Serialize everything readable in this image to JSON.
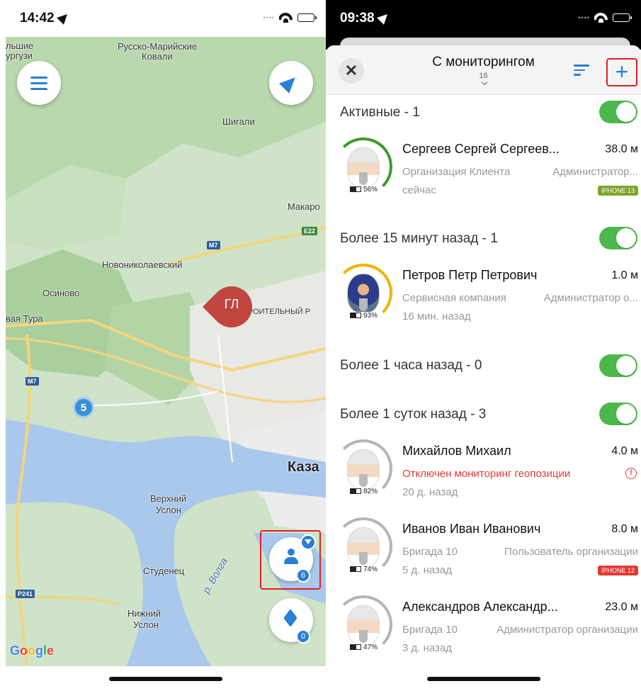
{
  "left": {
    "status": {
      "time": "14:42"
    },
    "map": {
      "labels": {
        "top_left": "льшие\nургузи",
        "russko": "Русско-Марийские",
        "kovali": "Ковали",
        "shigali": "Шигали",
        "makaro": "Макаро",
        "novonik": "Новониколаевский",
        "osinovo": "Осиново",
        "vaya_tura": "вая Тура",
        "stroitel": "РОИТЕЛЬНЫЙ Р",
        "kazan": "Каза",
        "verkhny": "Верхний",
        "uslon1": "Услон",
        "studenets": "Студенец",
        "nizhny": "Нижний",
        "uslon2": "Услон",
        "volga": "р. Волга"
      },
      "road_signs": {
        "m7a": "M7",
        "m7b": "M7",
        "e22": "E22",
        "p241": "P241"
      },
      "cluster_count": "5",
      "pin_initials": "ГЛ",
      "people_badge": "6",
      "layers_badge": "0",
      "google": "Google"
    }
  },
  "right": {
    "status": {
      "time": "09:38"
    },
    "header": {
      "close_label": "✕",
      "title": "С мониторингом",
      "count": "16",
      "add_label": "+"
    },
    "sections": [
      {
        "label": "Активные  - 1"
      },
      {
        "label": "Более 15 минут назад  - 1"
      },
      {
        "label": "Более 1 часа назад  - 0"
      },
      {
        "label": "Более 1 суток назад  - 3"
      }
    ],
    "contacts": [
      {
        "name": "Сергеев Сергей Сергеев...",
        "distance": "38.0 м",
        "org": "Организация Клиента",
        "role": "Администратор...",
        "time": "сейчас",
        "battery": "56%",
        "device": "IPHONE 13",
        "device_color": "#7ea52a",
        "ring_color": "#3e9b2f"
      },
      {
        "name": "Петров Петр Петрович",
        "distance": "1.0 м",
        "org": "Сервисная компания",
        "role": "Администратор о...",
        "time": "16 мин. назад",
        "battery": "93%",
        "ring_color": "#f0b400"
      },
      {
        "name": "Михайлов Михаил",
        "distance": "4.0 м",
        "warning": "Отключен мониторинг геопозиции",
        "time": "20 д. назад",
        "battery": "82%",
        "ring_color": "#b5b5b5"
      },
      {
        "name": "Иванов Иван Иванович",
        "distance": "8.0 м",
        "org": "Бригада 10",
        "role": "Пользователь организации",
        "time": "5 д. назад",
        "battery": "74%",
        "device": "IPHONE 12",
        "device_color": "#e53935",
        "ring_color": "#b5b5b5"
      },
      {
        "name": "Александров Александр...",
        "distance": "23.0 м",
        "org": "Бригада 10",
        "role": "Администратор организации",
        "time": "3 д. назад",
        "battery": "47%",
        "ring_color": "#b5b5b5"
      }
    ]
  }
}
